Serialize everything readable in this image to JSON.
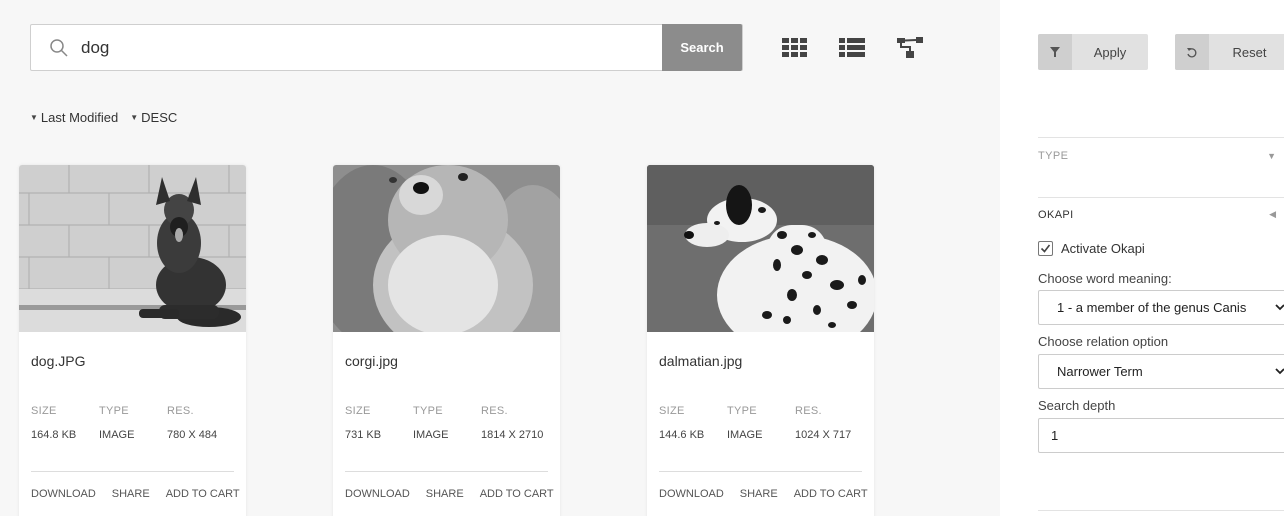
{
  "search": {
    "value": "dog",
    "button_label": "Search"
  },
  "views": [
    "grid-view-icon",
    "list-view-icon",
    "tree-view-icon"
  ],
  "sort": {
    "field": "Last Modified",
    "order": "DESC"
  },
  "cards": [
    {
      "filename": "dog.JPG",
      "size_label": "SIZE",
      "type_label": "TYPE",
      "res_label": "RES.",
      "size": "164.8 KB",
      "type": "IMAGE",
      "res": "780 X 484",
      "actions": [
        "DOWNLOAD",
        "SHARE",
        "ADD TO CART"
      ]
    },
    {
      "filename": "corgi.jpg",
      "size_label": "SIZE",
      "type_label": "TYPE",
      "res_label": "RES.",
      "size": "731 KB",
      "type": "IMAGE",
      "res": "1814 X 2710",
      "actions": [
        "DOWNLOAD",
        "SHARE",
        "ADD TO CART"
      ]
    },
    {
      "filename": "dalmatian.jpg",
      "size_label": "SIZE",
      "type_label": "TYPE",
      "res_label": "RES.",
      "size": "144.6 KB",
      "type": "IMAGE",
      "res": "1024 X 717",
      "actions": [
        "DOWNLOAD",
        "SHARE",
        "ADD TO CART"
      ]
    }
  ],
  "panel": {
    "apply_label": "Apply",
    "reset_label": "Reset",
    "type_section": "TYPE",
    "okapi_section": "OKAPI",
    "activate_label": "Activate Okapi",
    "activate_checked": true,
    "meaning_label": "Choose word meaning:",
    "meaning_value": "1 - a member of the genus Canis",
    "relation_label": "Choose relation option",
    "relation_value": "Narrower Term",
    "depth_label": "Search depth",
    "depth_value": "1"
  },
  "colors": {
    "search_button": "#8c8c8c",
    "main_background": "#f7f7f7",
    "button_background": "#e1e1e1"
  }
}
